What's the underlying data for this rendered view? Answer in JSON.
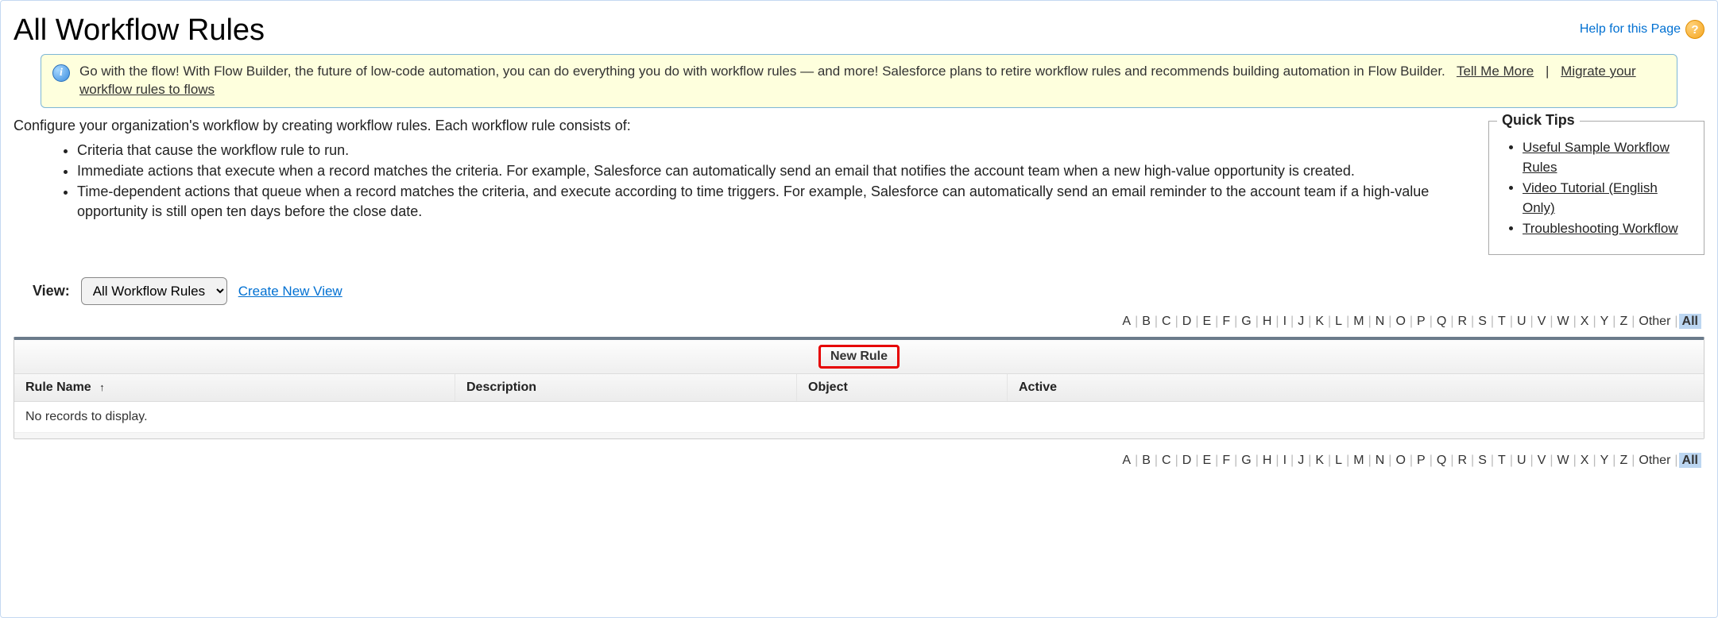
{
  "header": {
    "title": "All Workflow Rules",
    "help_label": "Help for this Page"
  },
  "banner": {
    "text": "Go with the flow! With Flow Builder, the future of low-code automation, you can do everything you do with workflow rules — and more! Salesforce plans to retire workflow rules and recommends building automation in Flow Builder.",
    "tell_me_more": "Tell Me More",
    "migrate_link": "Migrate your workflow rules to flows"
  },
  "intro": {
    "lead": "Configure your organization's workflow by creating workflow rules. Each workflow rule consists of:",
    "bullets": [
      "Criteria that cause the workflow rule to run.",
      "Immediate actions that execute when a record matches the criteria. For example, Salesforce can automatically send an email that notifies the account team when a new high-value opportunity is created.",
      "Time-dependent actions that queue when a record matches the criteria, and execute according to time triggers. For example, Salesforce can automatically send an email reminder to the account team if a high-value opportunity is still open ten days before the close date."
    ]
  },
  "quick_tips": {
    "title": "Quick Tips",
    "links": [
      "Useful Sample Workflow Rules",
      "Video Tutorial (English Only)",
      "Troubleshooting Workflow"
    ]
  },
  "view": {
    "label": "View:",
    "selected": "All Workflow Rules",
    "create_link": "Create New View"
  },
  "alpha": {
    "letters": [
      "A",
      "B",
      "C",
      "D",
      "E",
      "F",
      "G",
      "H",
      "I",
      "J",
      "K",
      "L",
      "M",
      "N",
      "O",
      "P",
      "Q",
      "R",
      "S",
      "T",
      "U",
      "V",
      "W",
      "X",
      "Y",
      "Z"
    ],
    "other": "Other",
    "all": "All"
  },
  "grid": {
    "new_rule_label": "New Rule",
    "columns": {
      "rule": "Rule Name",
      "desc": "Description",
      "obj": "Object",
      "active": "Active"
    },
    "empty_message": "No records to display."
  }
}
